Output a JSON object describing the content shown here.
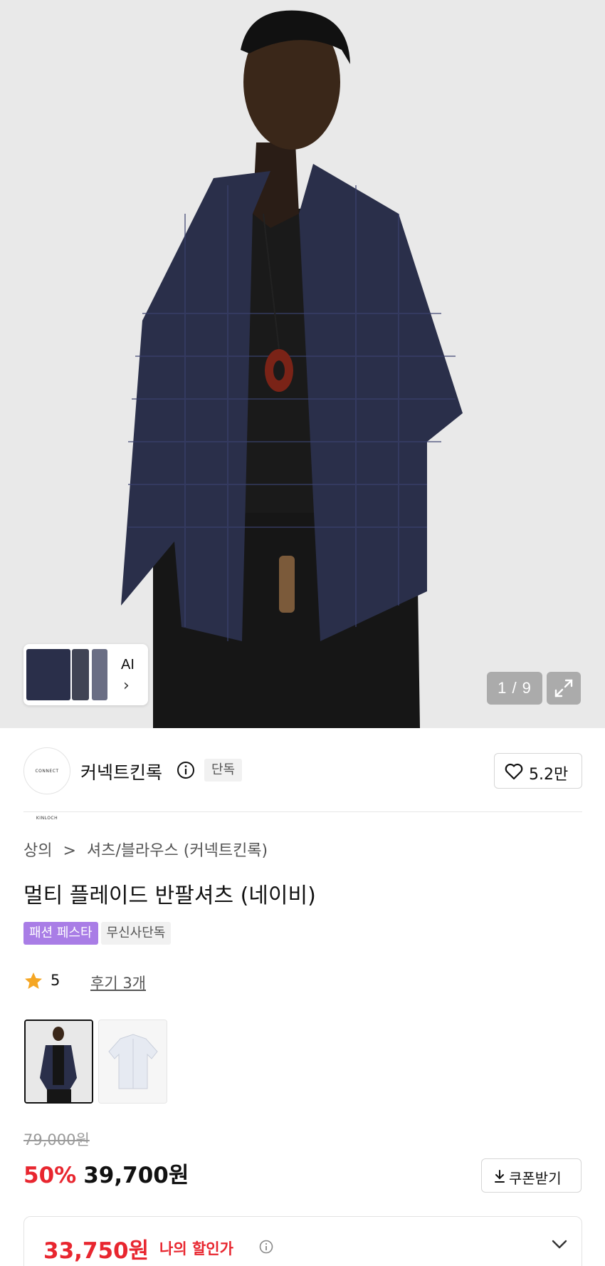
{
  "gallery": {
    "ai_thumb_label": "AI",
    "ai_thumb_arrow": "›",
    "counter": "1 / 9",
    "expand_icon": "expand-icon"
  },
  "brand": {
    "logo_text": "CONNECT KINLOCH",
    "name": "커넥트킨록",
    "exclusive_tag": "단독",
    "likes": "5.2만"
  },
  "product": {
    "breadcrumb": [
      "상의",
      "셔츠/블라우스 (커넥트킨록)"
    ],
    "breadcrumb_sep": ">",
    "title": "멀티 플레이드 반팔셔츠 (네이비)",
    "tags": [
      "패션 페스타",
      "무신사단독"
    ],
    "rating_score": "5",
    "reviews_label": "후기 3개"
  },
  "pricing": {
    "original": "79,000원",
    "discount": "50%",
    "sale": "39,700원",
    "coupon_button": "쿠폰받기",
    "my_price_value": "33,750원",
    "my_price_label": "나의 할인가"
  },
  "colors": {
    "accent_red": "#e8262f",
    "festa_purple": "#a97de6",
    "shirt_navy": "#2a2f4a"
  }
}
